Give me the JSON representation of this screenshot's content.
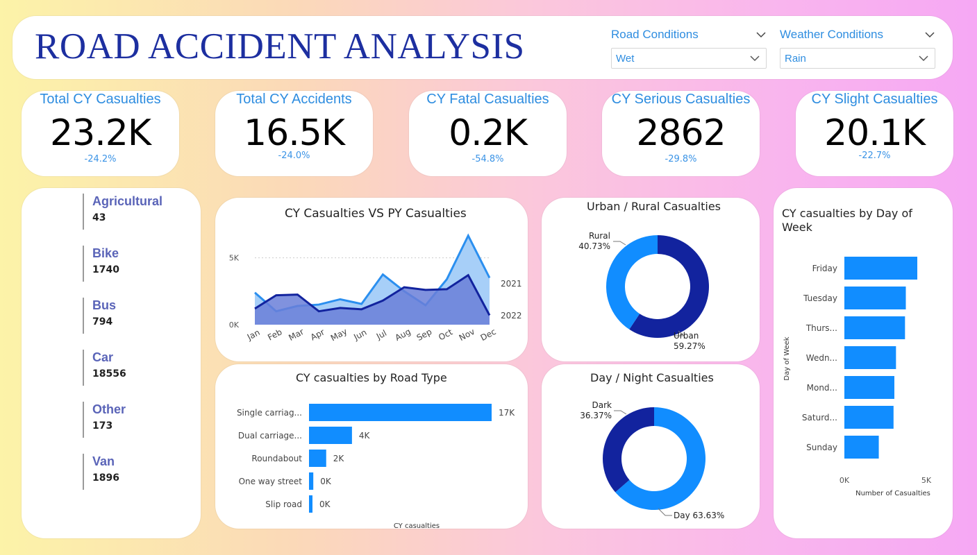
{
  "header": {
    "title": "ROAD ACCIDENT ANALYSIS",
    "slicers": [
      {
        "label": "Road Conditions",
        "value": "Wet"
      },
      {
        "label": "Weather Conditions",
        "value": "Rain"
      }
    ]
  },
  "kpis": [
    {
      "label": "Total CY Casualties",
      "value": "23.2K",
      "delta": "-24.2%"
    },
    {
      "label": "Total CY Accidents",
      "value": "16.5K",
      "delta": "-24.0%"
    },
    {
      "label": "CY Fatal Casualties",
      "value": "0.2K",
      "delta": "-54.8%"
    },
    {
      "label": "CY Serious Casualties",
      "value": "2862",
      "delta": "-29.8%"
    },
    {
      "label": "CY Slight Casualties",
      "value": "20.1K",
      "delta": "-22.7%"
    }
  ],
  "vehicles": [
    {
      "name": "Agricultural",
      "value": "43"
    },
    {
      "name": "Bike",
      "value": "1740"
    },
    {
      "name": "Bus",
      "value": "794"
    },
    {
      "name": "Car",
      "value": "18556"
    },
    {
      "name": "Other",
      "value": "173"
    },
    {
      "name": "Van",
      "value": "1896"
    }
  ],
  "colors": {
    "accent": "#2e8de0",
    "bar": "#118dff",
    "dark": "#12239e",
    "area_py": "#a7cff8",
    "area_cy": "#6a7fd8"
  },
  "chart_data": [
    {
      "type": "area",
      "title": "CY Casualties VS PY Casualties",
      "categories": [
        "Jan",
        "Feb",
        "Mar",
        "Apr",
        "May",
        "Jun",
        "Jul",
        "Aug",
        "Sep",
        "Oct",
        "Nov",
        "Dec"
      ],
      "yticks": [
        "0K",
        "5K"
      ],
      "ylim": [
        0,
        7000
      ],
      "series": [
        {
          "name": "2021",
          "values": [
            2400,
            1000,
            1400,
            1500,
            1900,
            1550,
            3750,
            2500,
            1450,
            3400,
            6650,
            3500
          ]
        },
        {
          "name": "2022",
          "values": [
            1200,
            2200,
            2250,
            1000,
            1250,
            1150,
            1800,
            2800,
            2600,
            2650,
            3700,
            700
          ]
        }
      ]
    },
    {
      "type": "pie",
      "title": "Urban / Rural Casualties",
      "slices": [
        {
          "label": "Urban",
          "value": 59.27,
          "text": "59.27%"
        },
        {
          "label": "Rural",
          "value": 40.73,
          "text": "40.73%"
        }
      ]
    },
    {
      "type": "bar",
      "title": "CY casualties by Road Type",
      "categories": [
        "Single carriag...",
        "Dual carriage...",
        "Roundabout",
        "One way street",
        "Slip road"
      ],
      "values": [
        17000,
        4000,
        1600,
        400,
        300
      ],
      "data_labels": [
        "17K",
        "4K",
        "2K",
        "0K",
        "0K"
      ],
      "xlabel": "CY casualties"
    },
    {
      "type": "pie",
      "title": "Day / Night Casualties",
      "slices": [
        {
          "label": "Day",
          "value": 63.63,
          "text": "63.63%"
        },
        {
          "label": "Dark",
          "value": 36.37,
          "text": "36.37%"
        }
      ]
    },
    {
      "type": "bar",
      "title": "CY casualties by Day of Week",
      "categories": [
        "Friday",
        "Tuesday",
        "Thurs...",
        "Wedn...",
        "Mond...",
        "Saturd...",
        "Sunday"
      ],
      "values": [
        4450,
        3750,
        3700,
        3150,
        3050,
        3000,
        2100
      ],
      "xticks": [
        "0K",
        "5K"
      ],
      "xlim": [
        0,
        5000
      ],
      "xlabel": "Number of Casualties",
      "ylabel": "Day of Week"
    }
  ]
}
